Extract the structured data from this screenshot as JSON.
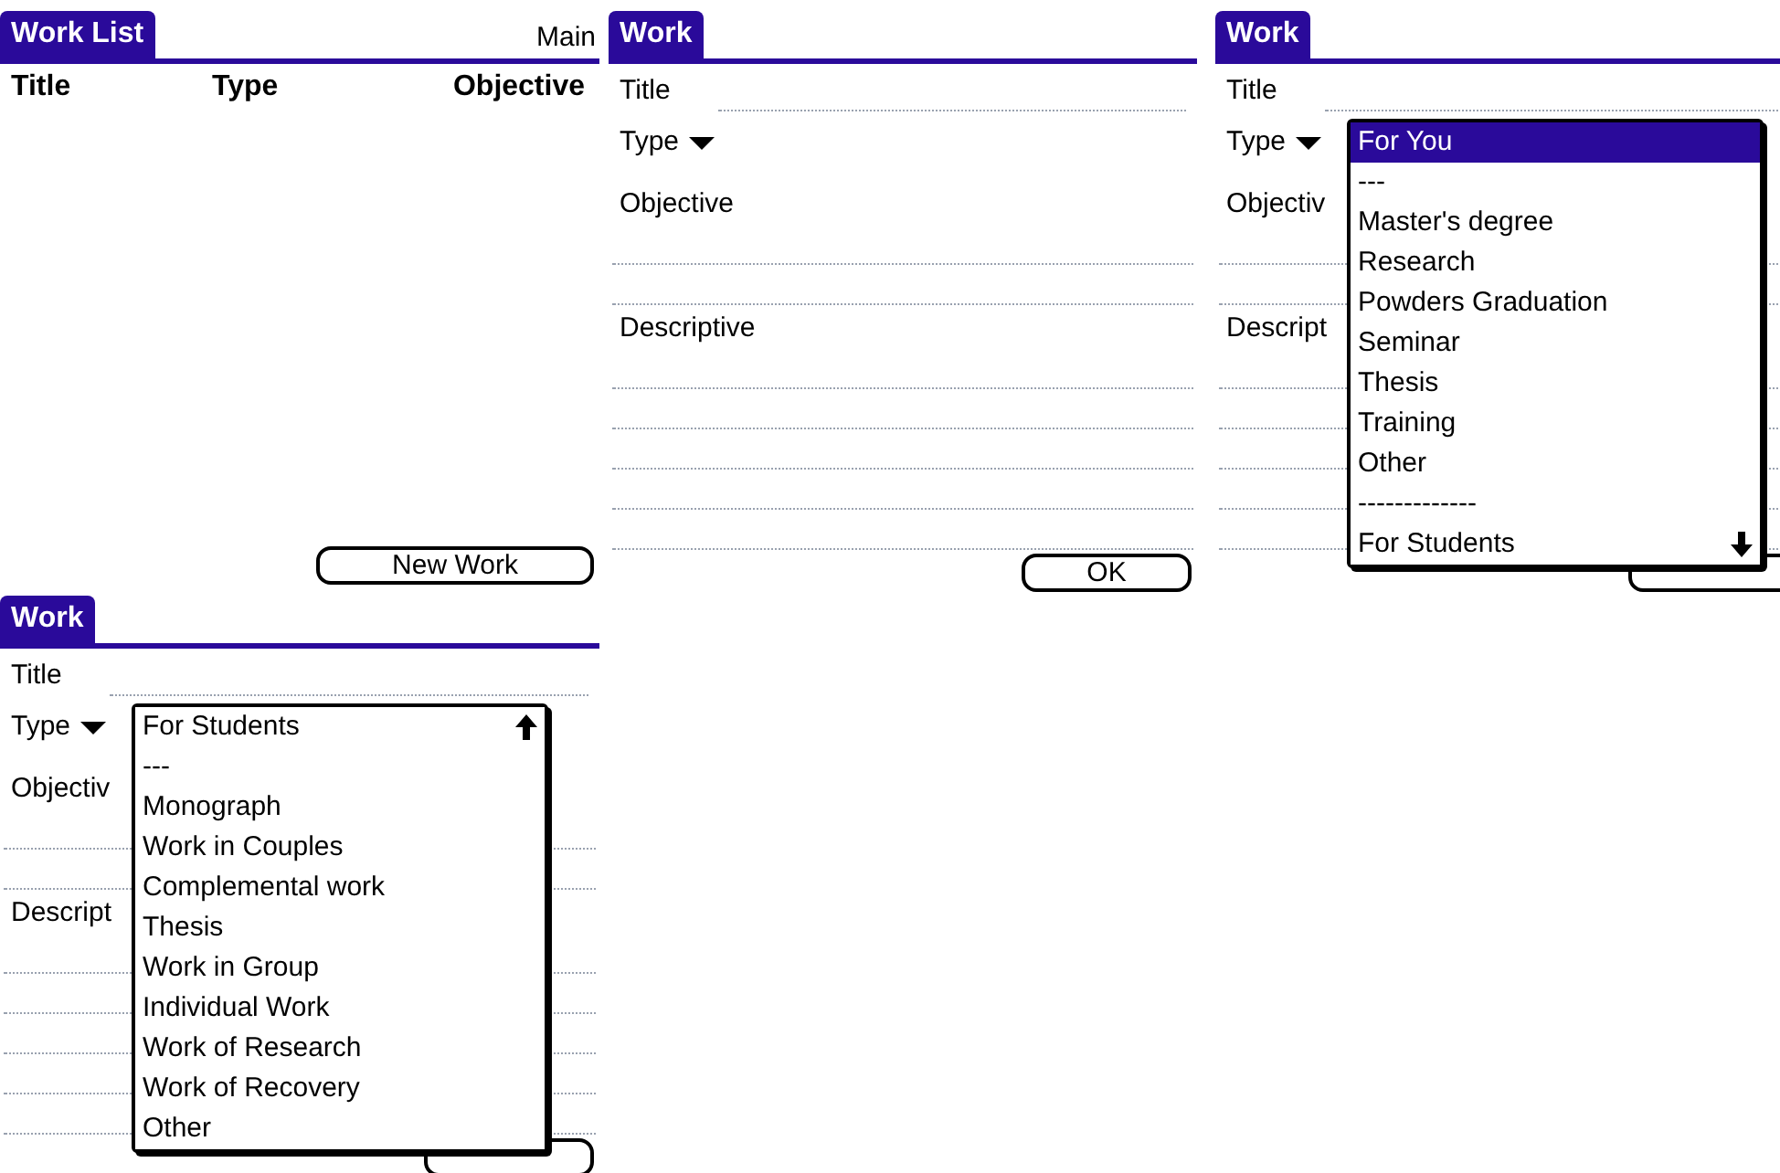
{
  "screens": [
    {
      "kind": "list",
      "title": "Work List",
      "menu": "Main",
      "columns": [
        "Title",
        "Type",
        "Objective"
      ],
      "button": "New Work"
    },
    {
      "kind": "form",
      "title": "Work",
      "title_label": "Title",
      "type_label": "Type",
      "objective_label": "Objective",
      "descriptive_label": "Descriptive",
      "button": "OK"
    },
    {
      "kind": "form",
      "title": "Work",
      "title_label": "Title",
      "type_label": "Type",
      "objective_label": "Objectiv",
      "descriptive_label": "Descript",
      "popup": {
        "more_above": false,
        "more_below": true,
        "items": [
          {
            "label": "For You",
            "selected": true
          },
          {
            "label": "---",
            "selected": false
          },
          {
            "label": "Master's degree",
            "selected": false
          },
          {
            "label": "Research",
            "selected": false
          },
          {
            "label": "Powders Graduation",
            "selected": false
          },
          {
            "label": "Seminar",
            "selected": false
          },
          {
            "label": "Thesis",
            "selected": false
          },
          {
            "label": "Training",
            "selected": false
          },
          {
            "label": "Other",
            "selected": false
          },
          {
            "label": "-------------",
            "selected": false
          },
          {
            "label": "For Students",
            "selected": false
          }
        ]
      }
    },
    {
      "kind": "form",
      "title": "Work",
      "title_label": "Title",
      "type_label": "Type",
      "objective_label": "Objectiv",
      "descriptive_label": "Descript",
      "popup": {
        "more_above": true,
        "more_below": false,
        "items": [
          {
            "label": "For Students",
            "selected": false
          },
          {
            "label": "---",
            "selected": false
          },
          {
            "label": "Monograph",
            "selected": false
          },
          {
            "label": "Work in Couples",
            "selected": false
          },
          {
            "label": "Complemental work",
            "selected": false
          },
          {
            "label": "Thesis",
            "selected": false
          },
          {
            "label": "Work in Group",
            "selected": false
          },
          {
            "label": "Individual Work",
            "selected": false
          },
          {
            "label": "Work of Research",
            "selected": false
          },
          {
            "label": "Work of Recovery",
            "selected": false
          },
          {
            "label": "Other",
            "selected": false
          }
        ]
      }
    }
  ]
}
